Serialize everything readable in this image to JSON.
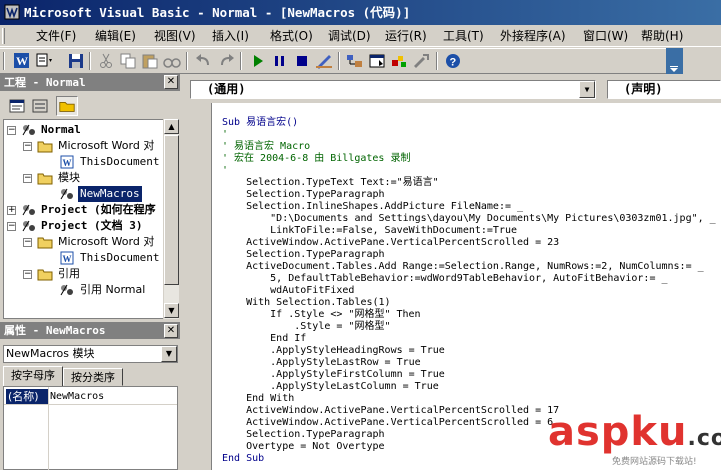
{
  "window": {
    "title": "Microsoft Visual Basic - Normal - [NewMacros (代码)]"
  },
  "menubar": {
    "items": [
      "文件(F)",
      "编辑(E)",
      "视图(V)",
      "插入(I)",
      "格式(O)",
      "调试(D)",
      "运行(R)",
      "工具(T)",
      "外接程序(A)",
      "窗口(W)",
      "帮助(H)"
    ]
  },
  "project": {
    "title": "工程 - Normal",
    "tree": [
      {
        "label": "Normal",
        "level": 0
      },
      {
        "label": "Microsoft Word 对",
        "level": 1
      },
      {
        "label": "ThisDocument",
        "level": 2
      },
      {
        "label": "模块",
        "level": 1
      },
      {
        "label": "NewMacros",
        "level": 2
      },
      {
        "label": "Project (如何在程序",
        "level": 0
      },
      {
        "label": "Project (文档 3)",
        "level": 0
      },
      {
        "label": "Microsoft Word 对",
        "level": 1
      },
      {
        "label": "ThisDocument",
        "level": 2
      },
      {
        "label": "引用",
        "level": 1
      },
      {
        "label": "引用 Normal",
        "level": 2
      }
    ]
  },
  "properties": {
    "title": "属性 - NewMacros",
    "object_value": "NewMacros 模块",
    "tabs": [
      "按字母序",
      "按分类序"
    ],
    "row_key": "(名称)",
    "row_value": "NewMacros"
  },
  "code_window": {
    "object_combo": "(通用)",
    "proc_combo": "(声明)",
    "lines": [
      {
        "t": "Sub 易语言宏()",
        "c": "kw"
      },
      {
        "t": "'",
        "c": "cm"
      },
      {
        "t": "' 易语言宏 Macro",
        "c": "cm"
      },
      {
        "t": "' 宏在 2004-6-8 由 Billgates 录制",
        "c": "cm"
      },
      {
        "t": "'",
        "c": "cm"
      },
      {
        "t": "    Selection.TypeText Text:=\"易语言\"",
        "c": ""
      },
      {
        "t": "    Selection.TypeParagraph",
        "c": ""
      },
      {
        "t": "    Selection.InlineShapes.AddPicture FileName:= _",
        "c": ""
      },
      {
        "t": "        \"D:\\Documents and Settings\\dayou\\My Documents\\My Pictures\\0303zm01.jpg\", _",
        "c": ""
      },
      {
        "t": "        LinkToFile:=False, SaveWithDocument:=True",
        "c": ""
      },
      {
        "t": "    ActiveWindow.ActivePane.VerticalPercentScrolled = 23",
        "c": ""
      },
      {
        "t": "    Selection.TypeParagraph",
        "c": ""
      },
      {
        "t": "    ActiveDocument.Tables.Add Range:=Selection.Range, NumRows:=2, NumColumns:= _",
        "c": ""
      },
      {
        "t": "        5, DefaultTableBehavior:=wdWord9TableBehavior, AutoFitBehavior:= _",
        "c": ""
      },
      {
        "t": "        wdAutoFitFixed",
        "c": ""
      },
      {
        "t": "    With Selection.Tables(1)",
        "c": ""
      },
      {
        "t": "        If .Style <> \"网格型\" Then",
        "c": ""
      },
      {
        "t": "            .Style = \"网格型\"",
        "c": ""
      },
      {
        "t": "        End If",
        "c": ""
      },
      {
        "t": "        .ApplyStyleHeadingRows = True",
        "c": ""
      },
      {
        "t": "        .ApplyStyleLastRow = True",
        "c": ""
      },
      {
        "t": "        .ApplyStyleFirstColumn = True",
        "c": ""
      },
      {
        "t": "        .ApplyStyleLastColumn = True",
        "c": ""
      },
      {
        "t": "    End With",
        "c": ""
      },
      {
        "t": "    ActiveWindow.ActivePane.VerticalPercentScrolled = 17",
        "c": ""
      },
      {
        "t": "    ActiveWindow.ActivePane.VerticalPercentScrolled = 6",
        "c": ""
      },
      {
        "t": "    Selection.TypeParagraph",
        "c": ""
      },
      {
        "t": "    Overtype = Not Overtype",
        "c": ""
      },
      {
        "t": "End Sub",
        "c": "kw"
      }
    ]
  },
  "watermark": {
    "brand": "aspku",
    "dot": ".com",
    "sub": "免费网站源码下载站!"
  },
  "icons": [
    "vba-app-icon",
    "word-view-icon",
    "insert-module-icon",
    "save-icon",
    "cut-icon",
    "copy-icon",
    "paste-icon",
    "find-icon",
    "undo-icon",
    "redo-icon",
    "run-icon",
    "break-icon",
    "reset-icon",
    "design-mode-icon",
    "project-explorer-icon",
    "properties-icon",
    "object-browser-icon",
    "toolbox-icon",
    "help-icon",
    "folder-icon",
    "module-icon",
    "word-doc-icon",
    "vba-project-icon",
    "reference-icon"
  ],
  "colors": {
    "title_gradient_start": "#0a246a",
    "title_gradient_end": "#3a6ea5",
    "panel_face": "#d4d0c8",
    "comment": "#006400",
    "keyword": "#00008b",
    "brand": "#e0332f"
  }
}
